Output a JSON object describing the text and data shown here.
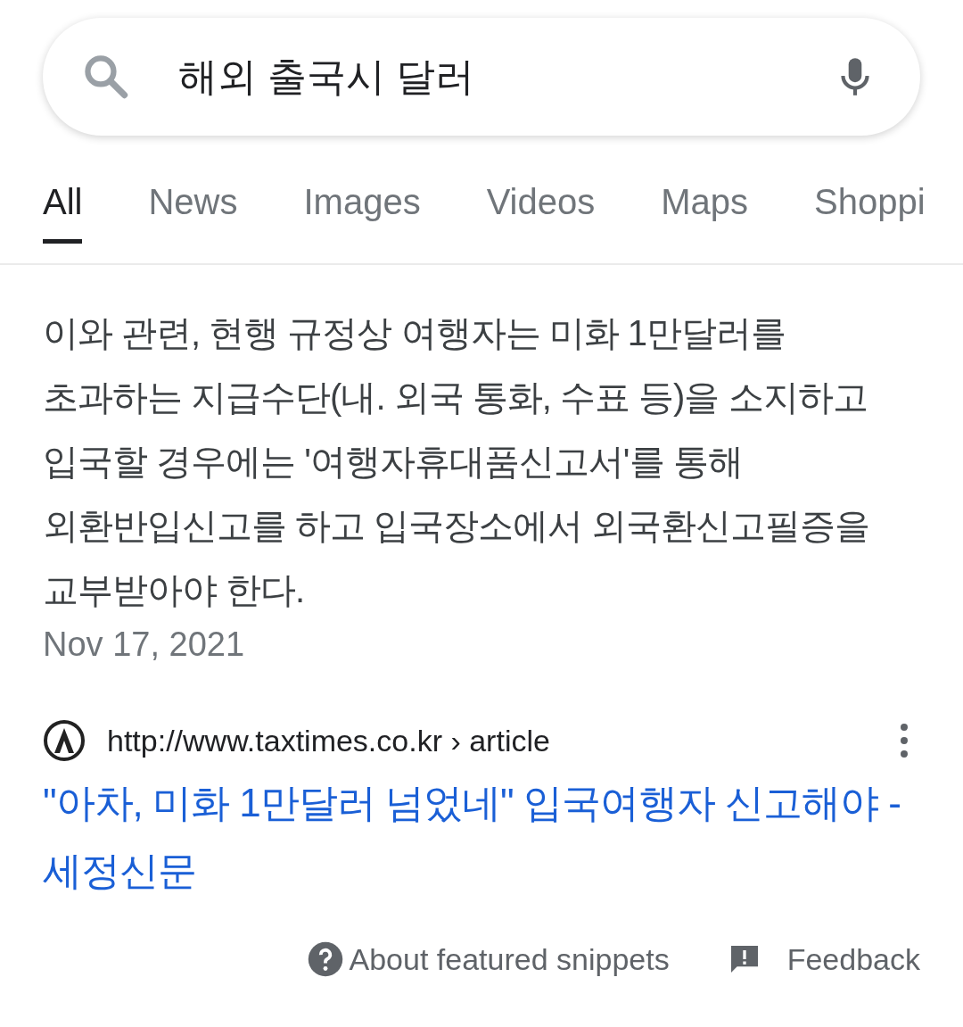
{
  "search": {
    "value": "해외 출국시 달러"
  },
  "tabs": [
    {
      "label": "All",
      "selected": true
    },
    {
      "label": "News",
      "selected": false
    },
    {
      "label": "Images",
      "selected": false
    },
    {
      "label": "Videos",
      "selected": false
    },
    {
      "label": "Maps",
      "selected": false
    },
    {
      "label": "Shoppi",
      "selected": false
    }
  ],
  "snippet": {
    "text": "이와 관련, 현행 규정상 여행자는 미화 1만달러를 초과하는 지급수단(내. 외국 통화, 수표 등)을 소지하고 입국할 경우에는 '여행자휴대품신고서'를 통해 외환반입신고를 하고 입국장소에서 외국환신고필증을 교부받아야 한다.",
    "date": "Nov 17, 2021"
  },
  "source": {
    "url": "http://www.taxtimes.co.kr › article",
    "title": "\"아차, 미화 1만달러 넘었네\" 입국여행자 신고해야 - 세정신문"
  },
  "footer": {
    "about": "About featured snippets",
    "feedback": "Feedback"
  }
}
